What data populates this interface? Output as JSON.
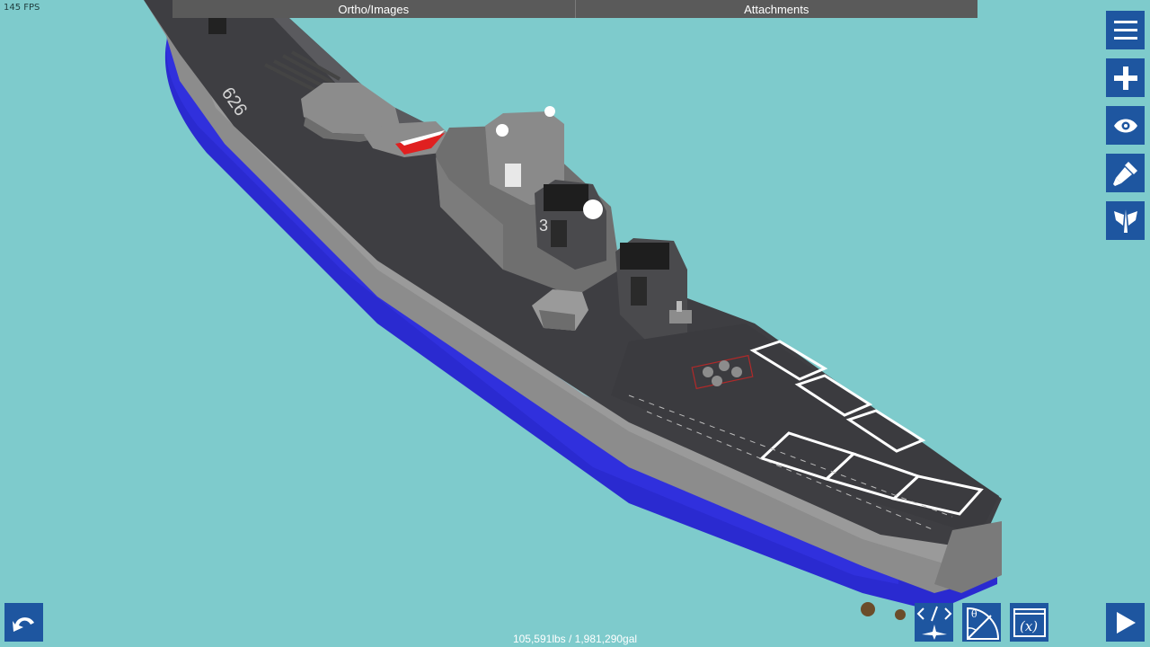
{
  "hud": {
    "fps": "145 FPS"
  },
  "top_tabs": [
    {
      "label": "Ortho/Images"
    },
    {
      "label": "Attachments"
    }
  ],
  "side_toolbar": [
    "menu-icon",
    "add-part-icon",
    "view-icon",
    "paint-brush-icon",
    "wing-symmetry-icon"
  ],
  "bottom_toolbar": [
    "undo-icon",
    "code-aircraft-icon",
    "angle-gauge-icon",
    "variables-icon",
    "play-icon"
  ],
  "ship": {
    "hull_number": "626",
    "superstructure_number": "3"
  },
  "status": {
    "mass_volume": "105,591lbs / 1,981,290gal"
  },
  "colors": {
    "background": "#7ecbcc",
    "hull_blue": "#2a2ad0",
    "hull_gray": "#8a8a8a",
    "deck": "#3e3e42",
    "button": "#1e56a0"
  }
}
